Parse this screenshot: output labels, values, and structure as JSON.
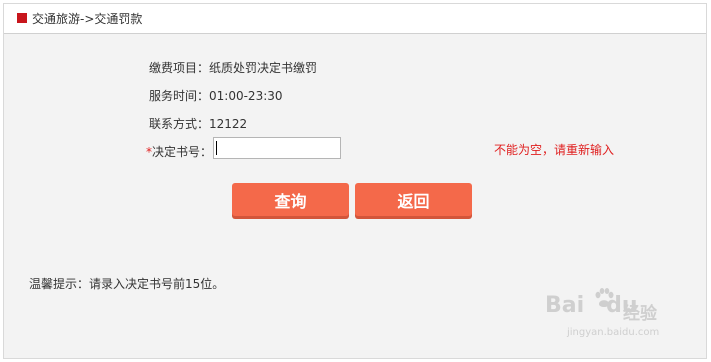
{
  "breadcrumb": {
    "text": "交通旅游->交通罚款"
  },
  "info": {
    "item_label": "缴费项目：",
    "item_value": "纸质处罚决定书缴罚",
    "service_label": "服务时间：",
    "service_value": "01:00-23:30",
    "contact_label": "联系方式：",
    "contact_value": "12122"
  },
  "form": {
    "required_mark": "*",
    "decision_label": "决定书号：",
    "decision_value": "",
    "error_text": "不能为空，请重新输入"
  },
  "buttons": {
    "query_label": "查询",
    "back_label": "返回"
  },
  "tip": {
    "text": "温馨提示：请录入决定书号前15位。"
  },
  "watermark": {
    "brand": "Bai",
    "brand_suffix": "du",
    "cn": "经验",
    "url": "jingyan.baidu.com"
  },
  "colors": {
    "accent_red": "#c8161d",
    "button": "#f4694a",
    "error": "#e02020"
  }
}
